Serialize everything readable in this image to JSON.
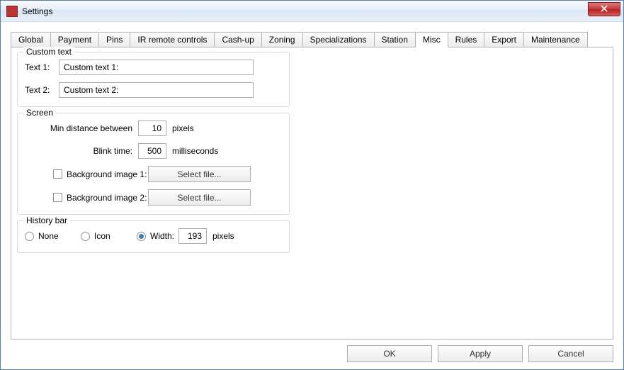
{
  "window": {
    "title": "Settings"
  },
  "tabs": {
    "global": "Global",
    "payment": "Payment",
    "pins": "Pins",
    "ir": "IR remote controls",
    "cashup": "Cash-up",
    "zoning": "Zoning",
    "specializations": "Specializations",
    "station": "Station",
    "misc": "Misc",
    "rules": "Rules",
    "export": "Export",
    "maintenance": "Maintenance"
  },
  "customText": {
    "group": "Custom text",
    "label1": "Text 1:",
    "value1": "Custom text 1:",
    "label2": "Text 2:",
    "value2": "Custom text 2:"
  },
  "screen": {
    "group": "Screen",
    "minDistLabel": "Min distance between",
    "minDistValue": "10",
    "pixels": "pixels",
    "blinkLabel": "Blink time:",
    "blinkValue": "500",
    "ms": "milliseconds",
    "bg1Label": "Background image 1:",
    "bg2Label": "Background image 2:",
    "selectFile": "Select file..."
  },
  "history": {
    "group": "History bar",
    "none": "None",
    "icon": "Icon",
    "width": "Width:",
    "widthValue": "193",
    "pixels": "pixels"
  },
  "buttons": {
    "ok": "OK",
    "apply": "Apply",
    "cancel": "Cancel"
  }
}
